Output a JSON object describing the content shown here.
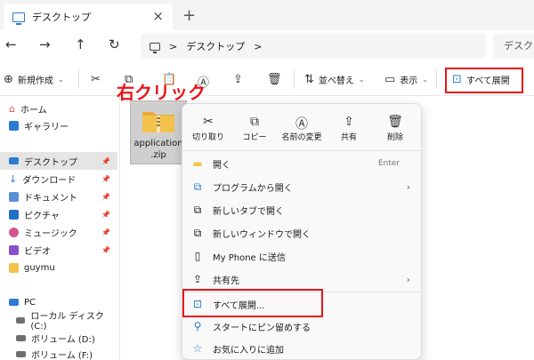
{
  "tab": {
    "title": "デスクトップ"
  },
  "nav": {
    "back": "←",
    "forward": "→",
    "up": "↑",
    "refresh": "↻"
  },
  "address": {
    "separator1": ">",
    "location": "デスクトップ",
    "separator2": ">"
  },
  "search": {
    "placeholder": "デスクト"
  },
  "toolbar": {
    "new_label": "新規作成",
    "sort_label": "並べ替え",
    "view_label": "表示",
    "extract_all_label": "すべて展開"
  },
  "sidebar": {
    "items": [
      {
        "label": "ホーム"
      },
      {
        "label": "ギャラリー"
      },
      {
        "label": "デスクトップ"
      },
      {
        "label": "ダウンロード"
      },
      {
        "label": "ドキュメント"
      },
      {
        "label": "ピクチャ"
      },
      {
        "label": "ミュージック"
      },
      {
        "label": "ビデオ"
      },
      {
        "label": "guymu"
      },
      {
        "label": "PC"
      },
      {
        "label": "ローカル ディスク (C:)"
      },
      {
        "label": "ボリューム (D:)"
      },
      {
        "label": "ボリューム (F:)"
      }
    ]
  },
  "annotation": {
    "right_click": "右クリック"
  },
  "file": {
    "line1": "application",
    "line2": ".zip"
  },
  "context_menu": {
    "quick": [
      "切り取り",
      "コピー",
      "名前の変更",
      "共有",
      "削除"
    ],
    "items": [
      {
        "label": "開く",
        "shortcut": "Enter"
      },
      {
        "label": "プログラムから開く"
      },
      {
        "label": "新しいタブで開く"
      },
      {
        "label": "新しいウィンドウで開く"
      },
      {
        "label": "My Phone に送信"
      },
      {
        "label": "共有先"
      },
      {
        "label": "すべて展開..."
      },
      {
        "label": "スタートにピン留めする"
      },
      {
        "label": "お気に入りに追加"
      }
    ]
  },
  "colors": {
    "highlight": "#e8151b",
    "accent": "#2b7cd3",
    "folder": "#f3c24d"
  }
}
